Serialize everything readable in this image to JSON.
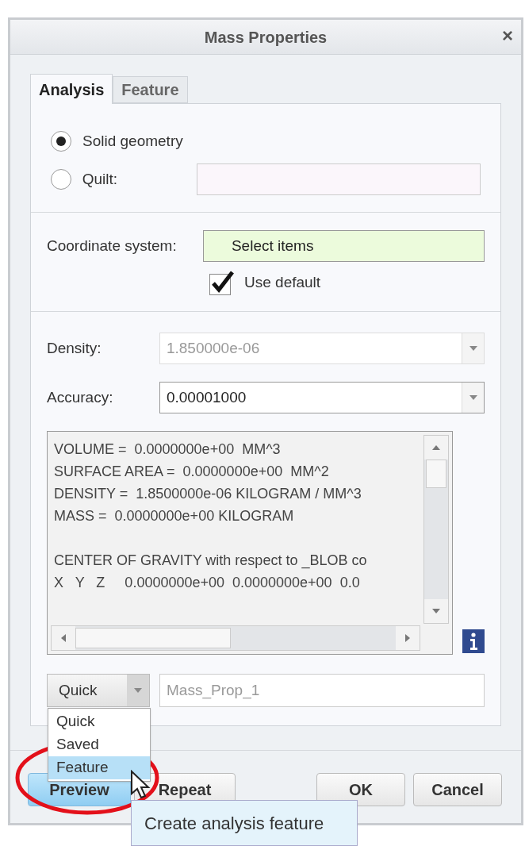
{
  "window": {
    "title": "Mass Properties",
    "close": "×"
  },
  "tabs": [
    {
      "label": "Analysis",
      "selected": true
    },
    {
      "label": "Feature",
      "selected": false
    }
  ],
  "geometry": [
    {
      "label": "Solid geometry",
      "selected": true
    },
    {
      "label": "Quilt:",
      "selected": false
    }
  ],
  "coordinate_system": {
    "label": "Coordinate system:",
    "value": "Select items",
    "use_default": {
      "label": "Use default",
      "checked": true
    }
  },
  "density": {
    "label": "Density:",
    "value": "1.850000e-06",
    "disabled": true
  },
  "accuracy": {
    "label": "Accuracy:",
    "value": "0.00001000",
    "disabled": false
  },
  "results": {
    "summary": [
      "VOLUME =  0.0000000e+00  MM^3",
      "SURFACE AREA =  0.0000000e+00  MM^2",
      "DENSITY =  1.8500000e-06 KILOGRAM / MM^3",
      "MASS =  0.0000000e+00 KILOGRAM"
    ],
    "center_of_gravity": [
      "CENTER OF GRAVITY with respect to _BLOB co",
      "X   Y   Z     0.0000000e+00  0.0000000e+00  0.0"
    ]
  },
  "mode": {
    "value": "Quick",
    "name_placeholder": "Mass_Prop_1",
    "options": [
      {
        "label": "Quick",
        "highlighted": false
      },
      {
        "label": "Saved",
        "highlighted": false
      },
      {
        "label": "Feature",
        "highlighted": true
      }
    ]
  },
  "buttons": [
    "Preview",
    "Repeat",
    "OK",
    "Cancel"
  ],
  "tooltip": "Create analysis feature"
}
